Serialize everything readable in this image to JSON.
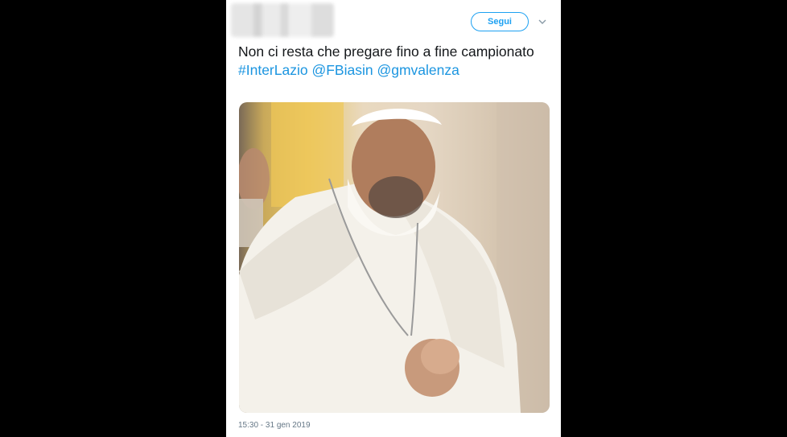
{
  "tweet": {
    "follow_label": "Segui",
    "text_plain": "Non ci resta che pregare fino a fine campionato ",
    "hashtag": "#InterLazio",
    "mention_1": "@FBiasin",
    "mention_2": "@gmvalenza",
    "timestamp": "15:30 - 31 gen 2019"
  },
  "icons": {
    "chevron": "chevron-down-icon"
  },
  "colors": {
    "accent": "#1da1f2",
    "link": "#1b95e0",
    "text": "#14171a",
    "muted": "#657786",
    "background": "#000000"
  }
}
